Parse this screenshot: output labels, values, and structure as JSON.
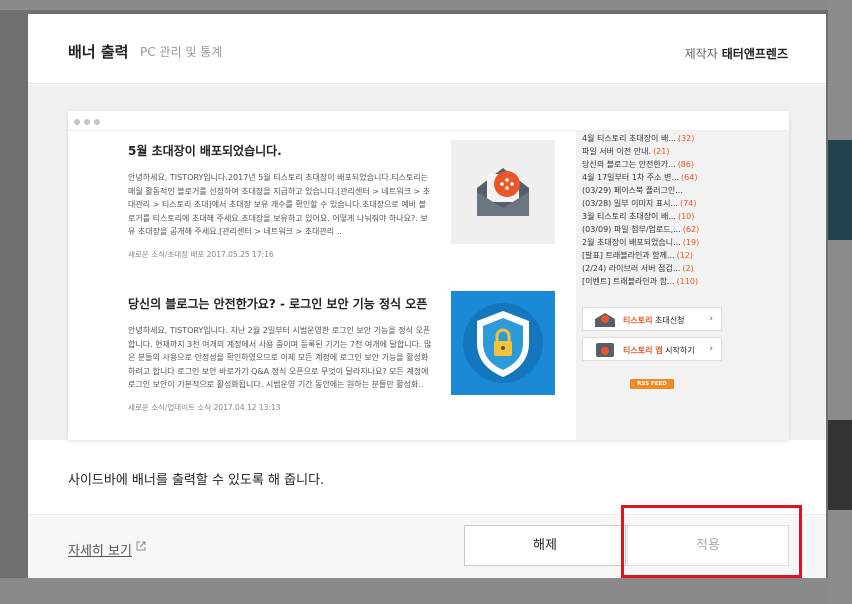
{
  "modal": {
    "title": "배너 출력",
    "subtitle": "PC 관리 및 통계",
    "author_label": "제작자",
    "author_name": "태터앤프렌즈",
    "description": "사이드바에 배너를 출력할 수 있도록 해 줍니다.",
    "detail_link": "자세히 보기",
    "release_button": "해제",
    "apply_button": "적용"
  },
  "preview": {
    "posts": [
      {
        "title": "5월 초대장이 배포되었습니다.",
        "body": "안녕하세요, TISTORY입니다.2017년 5월 티스토리 초대장이 배포되었습니다.티스토리는 매월 활동적인 블로거를 선정하여 초대장을 지급하고 있습니다.[관리센터 > 네트워크 > 초대관리 > 티스토리 초대]에서 초대장 보유 개수를 확인할 수 있습니다.초대장으로 예비 블로거를 티스토리에 초대해 주세요.초대장을 보유하고 있어요. 어떻게 나눠줘야 하나요?. 보유 초대장을 공개해 주세요.[관리센터 > 네트워크 > 초대관리 ..",
        "meta": "새로운 소식/초대장 배포   2017.05.25 17:16"
      },
      {
        "title": "당신의 블로그는 안전한가요? - 로그인 보안 기능 정식 오픈",
        "body": "안녕하세요, TISTORY입니다. 지난 2월 2일부터 시범운영한 로그인 보안 기능을 정식 오픈합니다. 현재까지 3천 여개의 계정에서 사용 중이며 등록된 기기는 7천 여개에 달합니다. 많은 분들의 사용으로 안정성을 확인하였으므로 이제 모든 계정에 로그인 보안 기능을 활성화하려고 합니다 로그인 보안 바로가기 Q&A 정식 오픈으로 무엇이 달라지나요? 모든 계정에 로그인 보안이 기본적으로 활성화됩니다. 시범운영 기간 동안에는 원하는 분들만 활성화..",
        "meta": "새로운 소식/업데이트 소식   2017.04.12 13:13"
      }
    ],
    "sidebar_items": [
      {
        "text": "4월 티스토리 초대장이 배...",
        "count": "(32)"
      },
      {
        "text": "파일 서버 이전 안내.",
        "count": "(21)"
      },
      {
        "text": "당신의 블로그는 안전한가...",
        "count": "(86)"
      },
      {
        "text": "4월 17일부터 1차 주소 변...",
        "count": "(64)"
      },
      {
        "text": "(03/29) 페이스북 플러그인...",
        "count": ""
      },
      {
        "text": "(03/28) 일부 이미지 표시...",
        "count": "(74)"
      },
      {
        "text": "3월 티스토리 초대장이 배...",
        "count": "(10)"
      },
      {
        "text": "(03/09) 파일 첨부/업로드,...",
        "count": "(62)"
      },
      {
        "text": "2월 초대장이 배포되었습니...",
        "count": "(19)"
      },
      {
        "text": "[발표] 트래블라인과 함께...",
        "count": "(12)"
      },
      {
        "text": "(2/24) 라이브러 서버 점검...",
        "count": "(2)"
      },
      {
        "text": "[이벤트] 트래블라인과 함...",
        "count": "(110)"
      }
    ],
    "invite_button": {
      "brand": "티스토리",
      "label": "초대신청"
    },
    "app_button": {
      "brand": "티스토리 앱",
      "label": "시작하기"
    },
    "rss_label": "RSS FEED"
  },
  "colors": {
    "accent_orange": "#e8572a",
    "highlight_red": "#e0141e",
    "shield_blue": "#1a8ad6"
  }
}
